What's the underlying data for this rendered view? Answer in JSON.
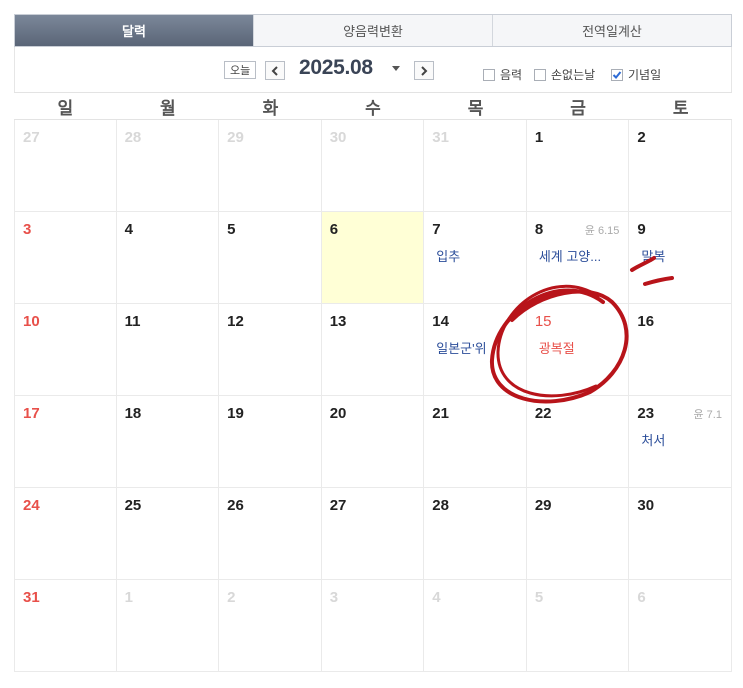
{
  "tabs": [
    {
      "label": "달력",
      "active": true
    },
    {
      "label": "양음력변환",
      "active": false
    },
    {
      "label": "전역일계산",
      "active": false
    }
  ],
  "toolbar": {
    "today_label": "오늘",
    "year_month": "2025.08",
    "options": [
      {
        "label": "음력",
        "checked": false
      },
      {
        "label": "손없는날",
        "checked": false
      },
      {
        "label": "기념일",
        "checked": true
      }
    ]
  },
  "weekdays": [
    "일",
    "월",
    "화",
    "수",
    "목",
    "금",
    "토"
  ],
  "days": [
    {
      "d": "27",
      "other": true
    },
    {
      "d": "28",
      "other": true
    },
    {
      "d": "29",
      "other": true
    },
    {
      "d": "30",
      "other": true
    },
    {
      "d": "31",
      "other": true
    },
    {
      "d": "1"
    },
    {
      "d": "2"
    },
    {
      "d": "3",
      "sun": true
    },
    {
      "d": "4"
    },
    {
      "d": "5"
    },
    {
      "d": "6",
      "today": true
    },
    {
      "d": "7",
      "event": "입추"
    },
    {
      "d": "8",
      "lunar": "윤 6.15",
      "event": "세계 고양..."
    },
    {
      "d": "9",
      "event": "말복"
    },
    {
      "d": "10",
      "sun": true
    },
    {
      "d": "11"
    },
    {
      "d": "12"
    },
    {
      "d": "13"
    },
    {
      "d": "14",
      "event": "일본군'위"
    },
    {
      "d": "15",
      "holiday": true,
      "event": "광복절",
      "event_holiday": true
    },
    {
      "d": "16"
    },
    {
      "d": "17",
      "sun": true
    },
    {
      "d": "18"
    },
    {
      "d": "19"
    },
    {
      "d": "20"
    },
    {
      "d": "21"
    },
    {
      "d": "22"
    },
    {
      "d": "23",
      "lunar": "윤 7.1",
      "event": "처서"
    },
    {
      "d": "24",
      "sun": true
    },
    {
      "d": "25"
    },
    {
      "d": "26"
    },
    {
      "d": "27"
    },
    {
      "d": "28"
    },
    {
      "d": "29"
    },
    {
      "d": "30"
    },
    {
      "d": "31",
      "sun": true
    },
    {
      "d": "1",
      "other": true
    },
    {
      "d": "2",
      "other": true
    },
    {
      "d": "3",
      "other": true
    },
    {
      "d": "4",
      "other": true
    },
    {
      "d": "5",
      "other": true
    },
    {
      "d": "6",
      "other": true
    }
  ]
}
